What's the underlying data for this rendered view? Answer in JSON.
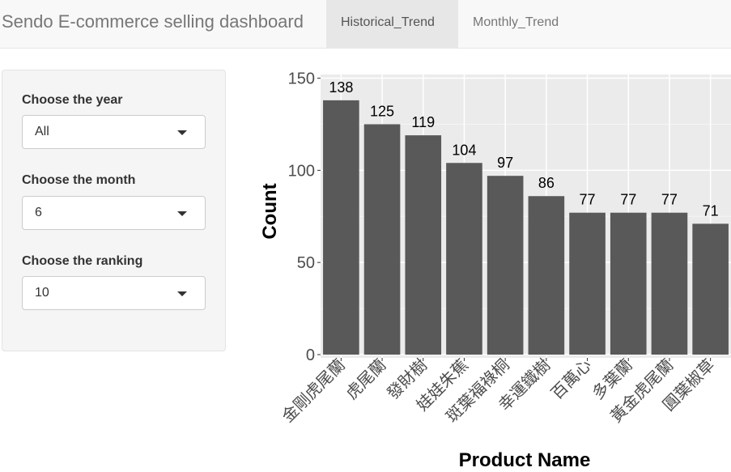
{
  "navbar": {
    "brand": "Sendo E-commerce selling dashboard",
    "tabs": [
      {
        "label": "Historical_Trend",
        "active": true
      },
      {
        "label": "Monthly_Trend",
        "active": false
      }
    ]
  },
  "sidebar": {
    "year": {
      "label": "Choose the year",
      "value": "All"
    },
    "month": {
      "label": "Choose the month",
      "value": "6"
    },
    "ranking": {
      "label": "Choose the ranking",
      "value": "10"
    }
  },
  "chart_data": {
    "type": "bar",
    "categories": [
      "金剛虎尾蘭",
      "虎尾蘭",
      "發財樹",
      "娃娃朱蕉",
      "斑葉福祿桐",
      "幸運鐵樹",
      "百萬心",
      "多葉蘭",
      "黃金虎尾蘭",
      "圓葉椒草"
    ],
    "values": [
      138,
      125,
      119,
      104,
      97,
      86,
      77,
      77,
      77,
      71
    ],
    "xlabel": "Product Name",
    "ylabel": "Count",
    "ylim": [
      0,
      152
    ],
    "yticks": [
      0,
      50,
      100,
      150
    ],
    "grid": true,
    "bar_color": "#595959",
    "panel_color": "#ebebeb"
  }
}
